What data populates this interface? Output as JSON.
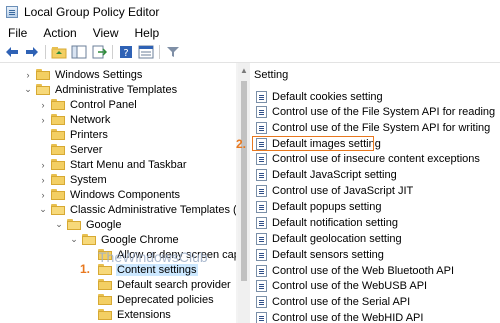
{
  "window": {
    "title": "Local Group Policy Editor"
  },
  "menu": [
    "File",
    "Action",
    "View",
    "Help"
  ],
  "toolbar_icons": [
    "back-icon",
    "forward-icon",
    "folder-up-icon",
    "show-hide-tree-icon",
    "export-icon",
    "help-icon",
    "properties-icon",
    "filter-icon"
  ],
  "tree": [
    {
      "label": "Windows Settings",
      "chev": "›"
    },
    {
      "label": "Administrative Templates",
      "chev": "⌄"
    },
    {
      "label": "Control Panel",
      "chev": "›"
    },
    {
      "label": "Network",
      "chev": "›"
    },
    {
      "label": "Printers",
      "chev": ""
    },
    {
      "label": "Server",
      "chev": ""
    },
    {
      "label": "Start Menu and Taskbar",
      "chev": "›"
    },
    {
      "label": "System",
      "chev": "›"
    },
    {
      "label": "Windows Components",
      "chev": "›"
    },
    {
      "label": "Classic Administrative Templates (ADI",
      "chev": "⌄"
    },
    {
      "label": "Google",
      "chev": "⌄"
    },
    {
      "label": "Google Chrome",
      "chev": "⌄"
    },
    {
      "label": "Allow or deny screen captu",
      "chev": ""
    },
    {
      "label": "Content settings",
      "chev": ""
    },
    {
      "label": "Default search provider",
      "chev": ""
    },
    {
      "label": "Deprecated policies",
      "chev": ""
    },
    {
      "label": "Extensions",
      "chev": ""
    }
  ],
  "settings_header": "Setting",
  "settings": [
    "Default cookies setting",
    "Control use of the File System API for reading",
    "Control use of the File System API for writing",
    "Default images setting",
    "Control use of insecure content exceptions",
    "Default JavaScript setting",
    "Control use of JavaScript JIT",
    "Default popups setting",
    "Default notification setting",
    "Default geolocation setting",
    "Default sensors setting",
    "Control use of the Web Bluetooth API",
    "Control use of the WebUSB API",
    "Control use of the Serial API",
    "Control use of the WebHID API"
  ],
  "annotations": {
    "one": "1.",
    "two": "2."
  },
  "watermark": "TheWindowsClub",
  "colors": {
    "annotation": "#e8781e",
    "selection": "#cce8ff",
    "folder": "#f3cf63"
  }
}
